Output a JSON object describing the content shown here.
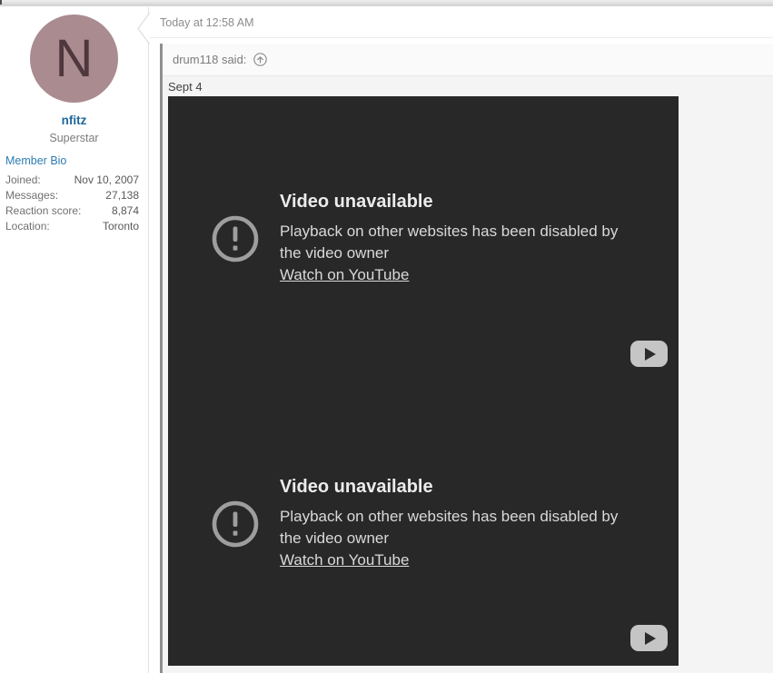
{
  "post": {
    "timestamp": "Today at 12:58 AM",
    "author": {
      "avatar_letter": "N",
      "username": "nfitz",
      "user_title": "Superstar",
      "bio_link_label": "Member Bio",
      "fields": [
        {
          "label": "Joined:",
          "value": "Nov 10, 2007"
        },
        {
          "label": "Messages:",
          "value": "27,138"
        },
        {
          "label": "Reaction score:",
          "value": "8,874"
        },
        {
          "label": "Location:",
          "value": "Toronto"
        }
      ]
    },
    "quote": {
      "header_label": "drum118 said:",
      "expand_icon": "arrow-up-circle-icon",
      "body_text": "Sept 4",
      "videos": [
        {
          "title": "Video unavailable",
          "message_lines": [
            "Playback on other websites has been disabled by",
            "the video owner"
          ],
          "link_label": "Watch on YouTube",
          "play_icon": "youtube-play-icon",
          "error_icon": "exclamation-circle-icon"
        },
        {
          "title": "Video unavailable",
          "message_lines": [
            "Playback on other websites has been disabled by",
            "the video owner"
          ],
          "link_label": "Watch on YouTube",
          "play_icon": "youtube-play-icon",
          "error_icon": "exclamation-circle-icon"
        }
      ]
    }
  },
  "colors": {
    "avatar_bg": "#a98b90",
    "avatar_letter": "#4e383e",
    "username_link": "#20689c",
    "bio_link": "#2e7cb2",
    "quote_bar": "#8f8f8f",
    "quote_header_bg": "#fafafa",
    "quote_body_bg": "#f4f4f4",
    "video_bg": "#282828",
    "video_text": "#d9d9d9",
    "video_icon_gray": "#9e9e9e",
    "play_button_bg": "#c5c5c5"
  }
}
